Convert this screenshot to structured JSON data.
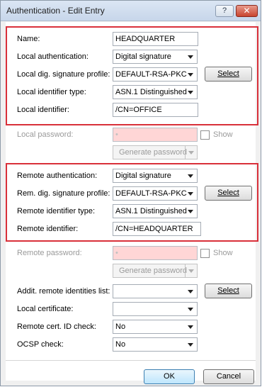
{
  "window": {
    "title": "Authentication - Edit Entry",
    "help_label": "?",
    "close_label": "✕"
  },
  "fields": {
    "name": {
      "label": "Name:",
      "value": "HEADQUARTER"
    },
    "local_auth": {
      "label": "Local authentication:",
      "value": "Digital signature"
    },
    "local_sig_profile": {
      "label": "Local dig. signature profile:",
      "value": "DEFAULT-RSA-PKC",
      "button": "Select"
    },
    "local_id_type": {
      "label": "Local identifier type:",
      "value": "ASN.1 Distinguished"
    },
    "local_id": {
      "label": "Local identifier:",
      "value": "/CN=OFFICE"
    },
    "local_password": {
      "label": "Local password:",
      "value": "•",
      "show_label": "Show",
      "generate_label": "Generate password"
    },
    "remote_auth": {
      "label": "Remote authentication:",
      "value": "Digital signature"
    },
    "remote_sig_profile": {
      "label": "Rem. dig. signature profile:",
      "value": "DEFAULT-RSA-PKC",
      "button": "Select"
    },
    "remote_id_type": {
      "label": "Remote identifier type:",
      "value": "ASN.1 Distinguished"
    },
    "remote_id": {
      "label": "Remote identifier:",
      "value": "/CN=HEADQUARTER"
    },
    "remote_password": {
      "label": "Remote password:",
      "value": "•",
      "show_label": "Show",
      "generate_label": "Generate password"
    },
    "addit_remote_list": {
      "label": "Addit. remote identities list:",
      "value": "",
      "button": "Select"
    },
    "local_certificate": {
      "label": "Local certificate:",
      "value": ""
    },
    "remote_cert_check": {
      "label": "Remote cert. ID check:",
      "value": "No"
    },
    "ocsp_check": {
      "label": "OCSP check:",
      "value": "No"
    }
  },
  "footer": {
    "ok_label": "OK",
    "cancel_label": "Cancel"
  },
  "colors": {
    "highlight_border": "#d9303a",
    "password_bg": "#ffd6d6"
  }
}
